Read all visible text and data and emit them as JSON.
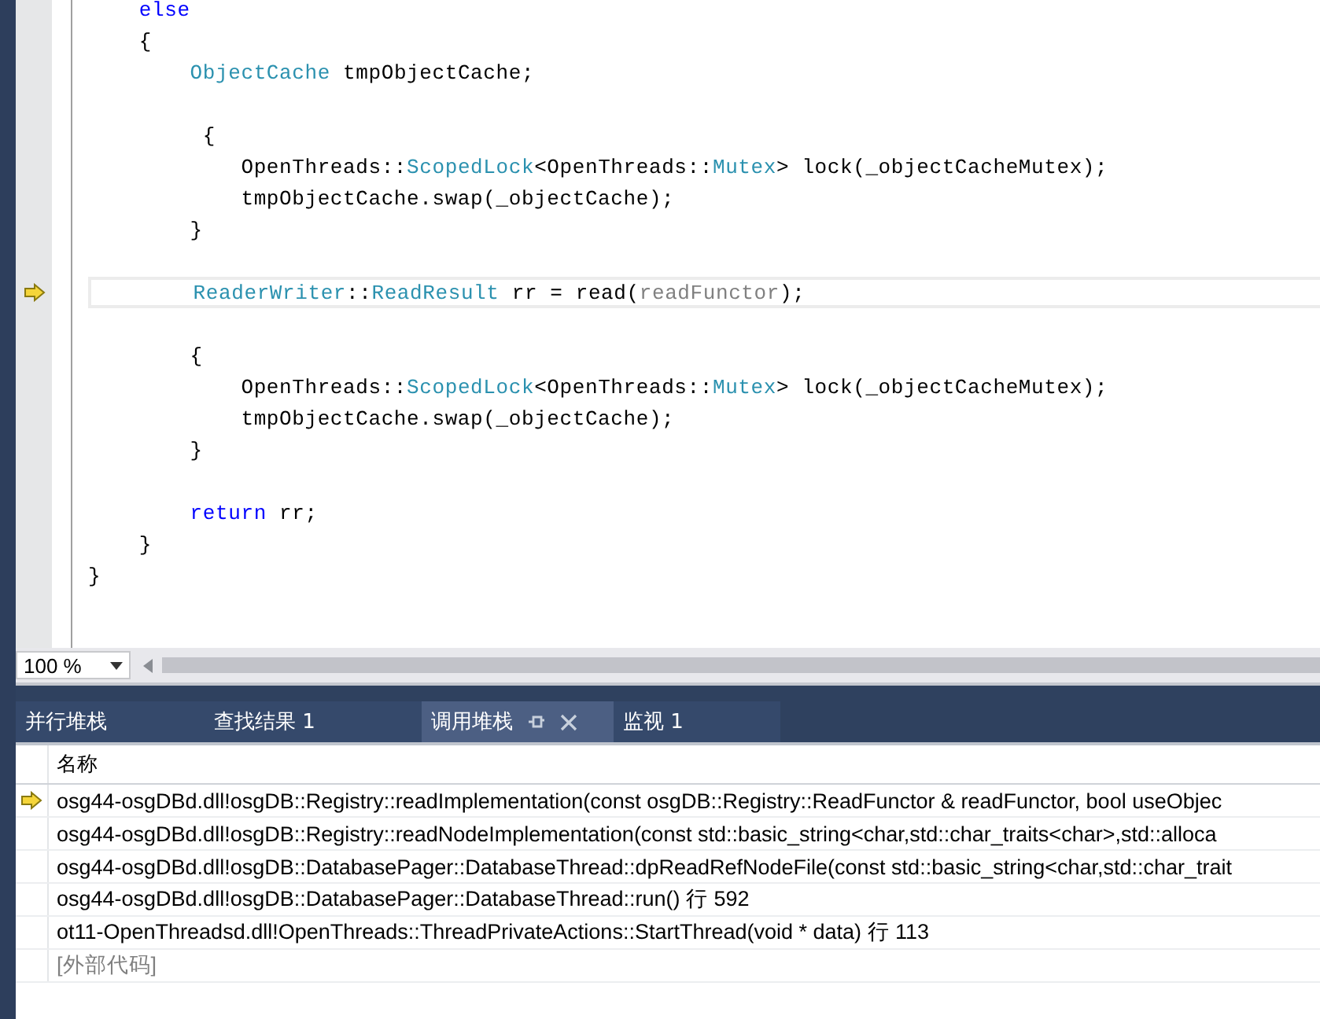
{
  "editor": {
    "lines": [
      {
        "current": false,
        "tokens": [
          {
            "kind": "keyword",
            "text": "    else"
          }
        ]
      },
      {
        "current": false,
        "tokens": [
          {
            "kind": "plain",
            "text": "    {"
          }
        ]
      },
      {
        "current": false,
        "tokens": [
          {
            "kind": "type",
            "text": "        ObjectCache"
          },
          {
            "kind": "plain",
            "text": " tmpObjectCache;"
          }
        ]
      },
      {
        "current": false
      },
      {
        "current": false,
        "tokens": [
          {
            "kind": "plain",
            "text": "         {"
          }
        ]
      },
      {
        "current": false,
        "tokens": [
          {
            "kind": "plain",
            "text": "            OpenThreads::"
          },
          {
            "kind": "type",
            "text": "ScopedLock"
          },
          {
            "kind": "plain",
            "text": "<OpenThreads::"
          },
          {
            "kind": "type",
            "text": "Mutex"
          },
          {
            "kind": "plain",
            "text": "> lock(_objectCacheMutex);"
          }
        ]
      },
      {
        "current": false,
        "tokens": [
          {
            "kind": "plain",
            "text": "            tmpObjectCache.swap(_objectCache);"
          }
        ]
      },
      {
        "current": false,
        "tokens": [
          {
            "kind": "plain",
            "text": "        }"
          }
        ]
      },
      {
        "current": false
      },
      {
        "current": true,
        "tokens": [
          {
            "kind": "type",
            "text": "        ReaderWriter"
          },
          {
            "kind": "plain",
            "text": "::"
          },
          {
            "kind": "type",
            "text": "ReadResult"
          },
          {
            "kind": "plain",
            "text": " rr = read("
          },
          {
            "kind": "param",
            "text": "readFunctor"
          },
          {
            "kind": "plain",
            "text": ");"
          }
        ]
      },
      {
        "current": false
      },
      {
        "current": false,
        "tokens": [
          {
            "kind": "plain",
            "text": "        {"
          }
        ]
      },
      {
        "current": false,
        "tokens": [
          {
            "kind": "plain",
            "text": "            OpenThreads::"
          },
          {
            "kind": "type",
            "text": "ScopedLock"
          },
          {
            "kind": "plain",
            "text": "<OpenThreads::"
          },
          {
            "kind": "type",
            "text": "Mutex"
          },
          {
            "kind": "plain",
            "text": "> lock(_objectCacheMutex);"
          }
        ]
      },
      {
        "current": false,
        "tokens": [
          {
            "kind": "plain",
            "text": "            tmpObjectCache.swap(_objectCache);"
          }
        ]
      },
      {
        "current": false,
        "tokens": [
          {
            "kind": "plain",
            "text": "        }"
          }
        ]
      },
      {
        "current": false
      },
      {
        "current": false,
        "tokens": [
          {
            "kind": "keyword",
            "text": "        return"
          },
          {
            "kind": "plain",
            "text": " rr;"
          }
        ]
      },
      {
        "current": false,
        "tokens": [
          {
            "kind": "plain",
            "text": "    }"
          }
        ]
      },
      {
        "current": false,
        "tokens": [
          {
            "kind": "plain",
            "text": "}"
          }
        ]
      }
    ],
    "zoom": "100 %"
  },
  "tool_tabs": [
    {
      "label": "并行堆栈",
      "selected": false
    },
    {
      "label": "查找结果 1",
      "selected": false
    },
    {
      "label": "调用堆栈",
      "selected": true
    },
    {
      "label": "监视 1",
      "selected": false
    }
  ],
  "call_stack": {
    "columns": [
      "名称"
    ],
    "rows": [
      {
        "kind": "frame",
        "current": true,
        "text": "osg44-osgDBd.dll!osgDB::Registry::readImplementation(const osgDB::Registry::ReadFunctor & readFunctor, bool useObjec"
      },
      {
        "kind": "frame",
        "current": false,
        "text": "osg44-osgDBd.dll!osgDB::Registry::readNodeImplementation(const std::basic_string<char,std::char_traits<char>,std::alloca"
      },
      {
        "kind": "frame",
        "current": false,
        "text": "osg44-osgDBd.dll!osgDB::DatabasePager::DatabaseThread::dpReadRefNodeFile(const std::basic_string<char,std::char_trait"
      },
      {
        "kind": "frame",
        "current": false,
        "text": "osg44-osgDBd.dll!osgDB::DatabasePager::DatabaseThread::run() 行 592"
      },
      {
        "kind": "frame",
        "current": false,
        "text": "ot11-OpenThreadsd.dll!OpenThreads::ThreadPrivateActions::StartThread(void * data) 行 113"
      },
      {
        "kind": "external",
        "current": false,
        "text": "[外部代码]"
      }
    ]
  }
}
